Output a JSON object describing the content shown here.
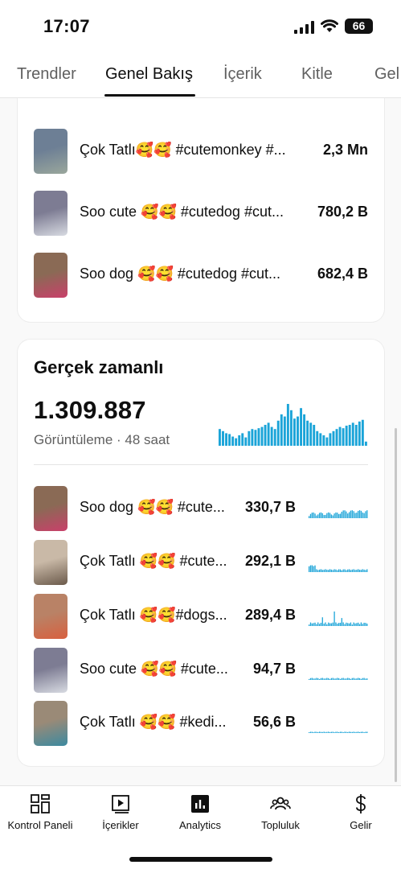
{
  "status_bar": {
    "time": "17:07",
    "battery": "66"
  },
  "tabs": [
    {
      "label": "Trendler"
    },
    {
      "label": "Genel Bakış"
    },
    {
      "label": "İçerik"
    },
    {
      "label": "Kitle"
    },
    {
      "label": "Gel"
    }
  ],
  "active_tab": "Genel Bakış",
  "top_list": [
    {
      "title": "Çok Tatlı🥰🥰 #cutemonkey #...",
      "value": "2,3 Mn",
      "thumb_colors": [
        "#6d7f95",
        "#9aa79c"
      ]
    },
    {
      "title": "Soo cute 🥰🥰 #cutedog #cut...",
      "value": "780,2 B",
      "thumb_colors": [
        "#7d7c93",
        "#d8dbe2"
      ]
    },
    {
      "title": "Soo dog 🥰🥰 #cutedog #cut...",
      "value": "682,4 B",
      "thumb_colors": [
        "#8a6a55",
        "#c9406a"
      ]
    }
  ],
  "realtime": {
    "title": "Gerçek zamanlı",
    "total": "1.309.887",
    "subtitle": "Görüntüleme · 48 saat",
    "accent": "#1ba4d8",
    "items": [
      {
        "title": "Soo dog 🥰🥰 #cute...",
        "value": "330,7 B",
        "thumb_colors": [
          "#8a6a55",
          "#c9406a"
        ]
      },
      {
        "title": "Çok Tatlı 🥰🥰 #cute...",
        "value": "292,1 B",
        "thumb_colors": [
          "#c9b9a7",
          "#6b5a4b"
        ]
      },
      {
        "title": "Çok Tatlı 🥰🥰#dogs...",
        "value": "289,4 B",
        "thumb_colors": [
          "#b98266",
          "#d8603f"
        ]
      },
      {
        "title": "Soo cute 🥰🥰 #cute...",
        "value": "94,7 B",
        "thumb_colors": [
          "#7d7c93",
          "#d8dbe2"
        ]
      },
      {
        "title": "Çok Tatlı 🥰🥰 #kedi...",
        "value": "56,6 B",
        "thumb_colors": [
          "#9a8a77",
          "#3c8aa0"
        ]
      }
    ]
  },
  "bottom_nav": [
    {
      "label": "Kontrol Paneli",
      "icon": "dashboard-icon"
    },
    {
      "label": "İçerikler",
      "icon": "video-library-icon"
    },
    {
      "label": "Analytics",
      "icon": "analytics-icon"
    },
    {
      "label": "Topluluk",
      "icon": "community-icon"
    },
    {
      "label": "Gelir",
      "icon": "dollar-icon"
    }
  ]
}
